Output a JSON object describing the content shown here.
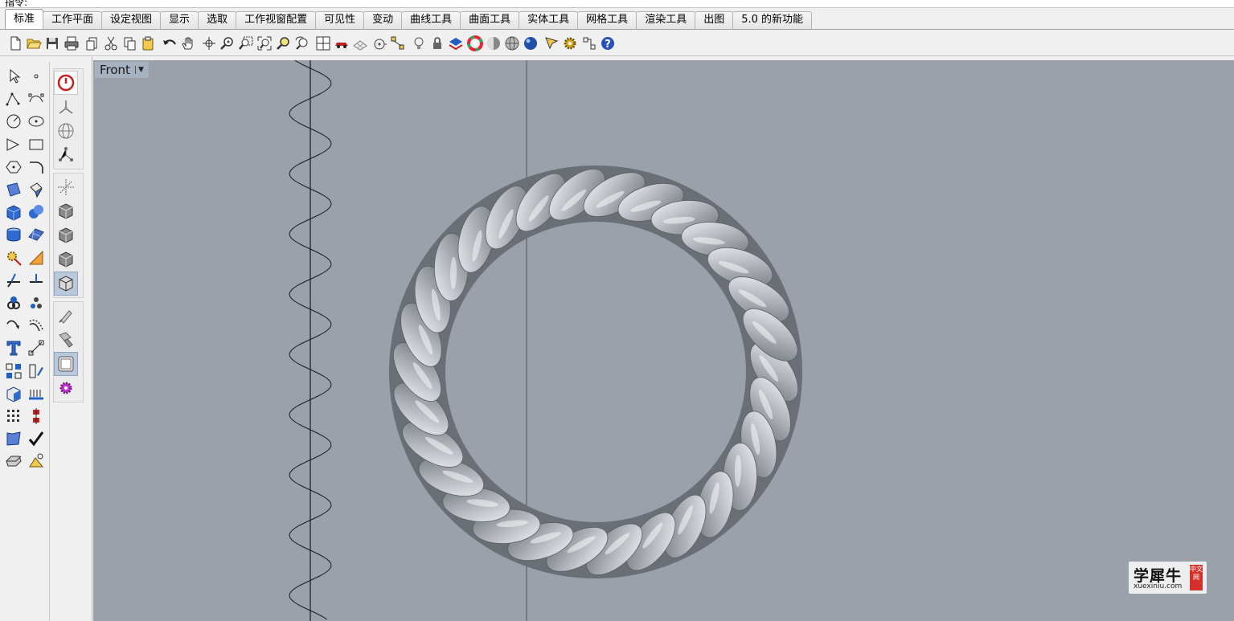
{
  "command": {
    "label": "指令:"
  },
  "tabs": [
    {
      "label": "标准",
      "active": true
    },
    {
      "label": "工作平面"
    },
    {
      "label": "设定视图"
    },
    {
      "label": "显示"
    },
    {
      "label": "选取"
    },
    {
      "label": "工作视窗配置"
    },
    {
      "label": "可见性"
    },
    {
      "label": "变动"
    },
    {
      "label": "曲线工具"
    },
    {
      "label": "曲面工具"
    },
    {
      "label": "实体工具"
    },
    {
      "label": "网格工具"
    },
    {
      "label": "渲染工具"
    },
    {
      "label": "出图"
    },
    {
      "label": "5.0 的新功能"
    }
  ],
  "toolbar_icons": [
    "new-file-icon",
    "open-folder-icon",
    "save-icon",
    "print-icon",
    "import-icon",
    "cut-icon",
    "copy-icon",
    "paste-icon",
    "undo-icon",
    "pan-hand-icon",
    "rotate-view-icon",
    "zoom-in-icon",
    "zoom-window-icon",
    "zoom-extents-icon",
    "zoom-selected-icon",
    "undo-view-icon",
    "four-viewports-icon",
    "car-render-icon",
    "grid-snap-icon",
    "target-icon",
    "points-icon",
    "bulb-icon",
    "lock-icon",
    "layers-icon",
    "color-wheel-icon",
    "sphere-shade-icon",
    "sphere-ghost-icon",
    "sphere-render-icon",
    "pen-tool-icon",
    "gear-settings-icon",
    "options-icon",
    "help-icon"
  ],
  "colors": {
    "viewport_bg": "#9aa1aa",
    "title_bg": "#a7b2c1",
    "accent_blue": "#1f5fc6",
    "accent_red": "#c0201e",
    "rope": "#b9bdc3"
  },
  "viewport": {
    "name": "Front"
  },
  "watermark": {
    "title": "学犀牛",
    "domain": "xuexiniu.com",
    "seal": "中文网"
  }
}
